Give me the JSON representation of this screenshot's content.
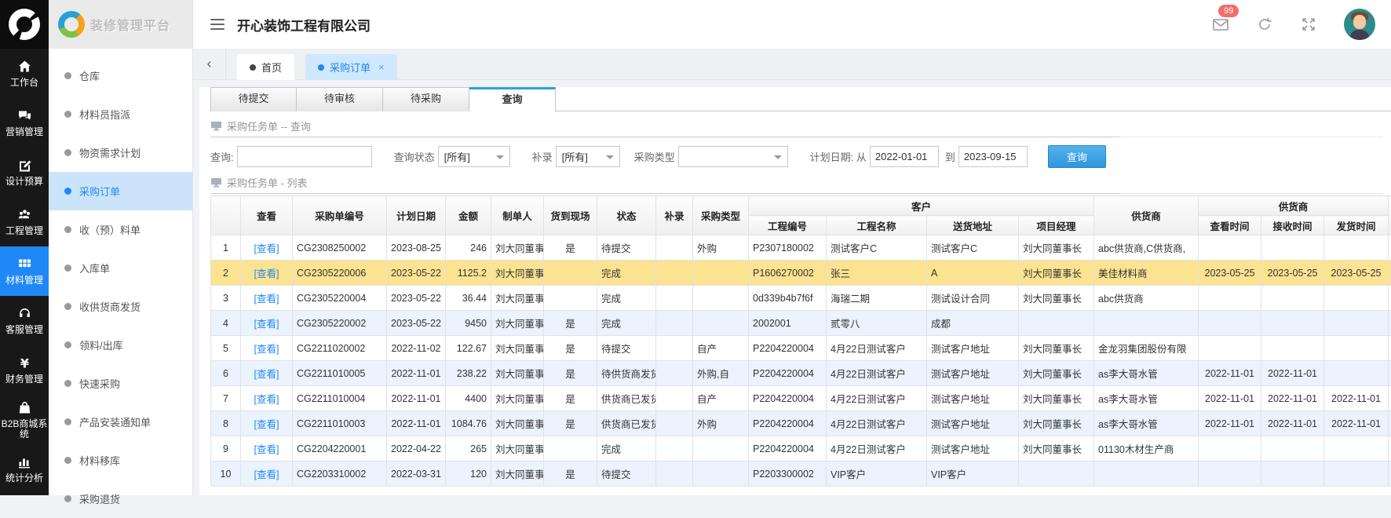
{
  "brand": {
    "logo_text": "装修管理平台"
  },
  "header": {
    "company": "开心装饰工程有限公司",
    "mail_badge": "99",
    "icons": [
      "mail-icon",
      "refresh-icon",
      "fullscreen-icon",
      "avatar"
    ]
  },
  "nav": {
    "active": "材料管理",
    "items": [
      {
        "label": "工作台",
        "icon": "home-icon"
      },
      {
        "label": "营销管理",
        "icon": "chat-icon"
      },
      {
        "label": "设计预算",
        "icon": "edit-icon"
      },
      {
        "label": "工程管理",
        "icon": "team-icon"
      },
      {
        "label": "材料管理",
        "icon": "grid-icon",
        "active": true
      },
      {
        "label": "客服管理",
        "icon": "headset-icon"
      },
      {
        "label": "财务管理",
        "icon": "yen-icon"
      },
      {
        "label": "B2B商城系统",
        "icon": "bag-icon"
      },
      {
        "label": "统计分析",
        "icon": "chart-icon"
      }
    ]
  },
  "sidebar": {
    "active": "采购订单",
    "items": [
      {
        "label": "仓库"
      },
      {
        "label": "材料员指派"
      },
      {
        "label": "物资需求计划"
      },
      {
        "label": "采购订单",
        "active": true
      },
      {
        "label": "收（预）料单"
      },
      {
        "label": "入库单"
      },
      {
        "label": "收供货商发货"
      },
      {
        "label": "领料/出库"
      },
      {
        "label": "快速采购"
      },
      {
        "label": "产品安装通知单"
      },
      {
        "label": "材料移库"
      },
      {
        "label": "采购退货"
      }
    ]
  },
  "window_tabs": [
    {
      "label": "首页",
      "active": false,
      "closable": false
    },
    {
      "label": "采购订单",
      "active": true,
      "closable": true,
      "close_glyph": "×"
    }
  ],
  "tab_scroll_left_glyph": "‹",
  "subtabs": {
    "active_index": 3,
    "items": [
      "待提交",
      "待审核",
      "待采购",
      "查询"
    ]
  },
  "sections": {
    "query_title": "采购任务单 -- 查询",
    "list_title": "采购任务单 - 列表"
  },
  "filters": {
    "query_label": "查询:",
    "query_value": "",
    "status_label": "查询状态",
    "status_value": "[所有]",
    "supplement_label": "补录",
    "supplement_value": "[所有]",
    "type_label": "采购类型",
    "type_value": "",
    "date_label": "计划日期: 从",
    "date_from": "2022-01-01",
    "date_to_label": "到",
    "date_to": "2023-09-15",
    "search_button": "查询"
  },
  "table": {
    "columns_simple": [
      "",
      "查看",
      "采购单编号",
      "计划日期",
      "金额",
      "制单人",
      "货到现场",
      "状态",
      "补录",
      "采购类型"
    ],
    "customer_group": {
      "label": "客户",
      "columns": [
        "工程编号",
        "工程名称",
        "送货地址",
        "项目经理"
      ]
    },
    "supplier_column": "供货商",
    "supplier_group": {
      "label": "供货商",
      "columns": [
        "查看时间",
        "接收时间",
        "发货时间"
      ]
    },
    "view_link_text": "[查看]",
    "highlight_row_index": 1,
    "rows": [
      [
        "1",
        "[查看]",
        "CG2308250002",
        "2023-08-25",
        "246",
        "刘大同董事长",
        "是",
        "待提交",
        "",
        "外购",
        "P2307180002",
        "测试客户C",
        "测试客户C",
        "刘大同董事长",
        "abc供货商,C供货商,",
        "",
        "",
        ""
      ],
      [
        "2",
        "[查看]",
        "CG2305220006",
        "2023-05-22",
        "1125.2",
        "刘大同董事长",
        "",
        "完成",
        "",
        "",
        "P1606270002",
        "张三",
        "A",
        "刘大同董事长",
        "美佳材料商",
        "2023-05-25",
        "2023-05-25",
        "2023-05-25"
      ],
      [
        "3",
        "[查看]",
        "CG2305220004",
        "2023-05-22",
        "36.44",
        "刘大同董事长",
        "",
        "完成",
        "",
        "",
        "0d339b4b7f6f",
        "海瑞二期",
        "测试设计合同",
        "刘大同董事长",
        "abc供货商",
        "",
        "",
        ""
      ],
      [
        "4",
        "[查看]",
        "CG2305220002",
        "2023-05-22",
        "9450",
        "刘大同董事长",
        "是",
        "完成",
        "",
        "",
        "2002001",
        "贰零八",
        "成都",
        "",
        "",
        "",
        "",
        ""
      ],
      [
        "5",
        "[查看]",
        "CG2211020002",
        "2022-11-02",
        "122.67",
        "刘大同董事长",
        "是",
        "待提交",
        "",
        "自产",
        "P2204220004",
        "4月22日测试客户",
        "测试客户地址",
        "刘大同董事长",
        "金龙羽集团股份有限",
        "",
        "",
        ""
      ],
      [
        "6",
        "[查看]",
        "CG2211010005",
        "2022-11-01",
        "238.22",
        "刘大同董事长",
        "是",
        "待供货商发货",
        "",
        "外购,自",
        "P2204220004",
        "4月22日测试客户",
        "测试客户地址",
        "刘大同董事长",
        "as李大哥水管",
        "2022-11-01",
        "2022-11-01",
        ""
      ],
      [
        "7",
        "[查看]",
        "CG2211010004",
        "2022-11-01",
        "4400",
        "刘大同董事长",
        "是",
        "供货商已发货",
        "",
        "自产",
        "P2204220004",
        "4月22日测试客户",
        "测试客户地址",
        "刘大同董事长",
        "as李大哥水管",
        "2022-11-01",
        "2022-11-01",
        "2022-11-01"
      ],
      [
        "8",
        "[查看]",
        "CG2211010003",
        "2022-11-01",
        "1084.76",
        "刘大同董事长",
        "是",
        "供货商已发货",
        "",
        "外购",
        "P2204220004",
        "4月22日测试客户",
        "测试客户地址",
        "刘大同董事长",
        "as李大哥水管",
        "2022-11-01",
        "2022-11-01",
        "2022-11-01"
      ],
      [
        "9",
        "[查看]",
        "CG2204220001",
        "2022-04-22",
        "265",
        "刘大同董事长",
        "",
        "完成",
        "",
        "",
        "P2204220004",
        "4月22日测试客户",
        "测试客户地址",
        "刘大同董事长",
        "01130木材生产商",
        "",
        "",
        ""
      ],
      [
        "10",
        "[查看]",
        "CG2203310002",
        "2022-03-31",
        "120",
        "刘大同董事长",
        "是",
        "待提交",
        "",
        "",
        "P2203300002",
        "VIP客户",
        "VIP客户",
        "",
        "",
        "",
        "",
        ""
      ]
    ]
  },
  "colors": {
    "accent_blue": "#1e88f7",
    "subtab_active_border": "#2ba0e0",
    "row_highlight": "#fbe391",
    "row_stripe": "#eaf3fe",
    "badge_red": "#f56c6c",
    "sidebar_black": "#181818"
  }
}
